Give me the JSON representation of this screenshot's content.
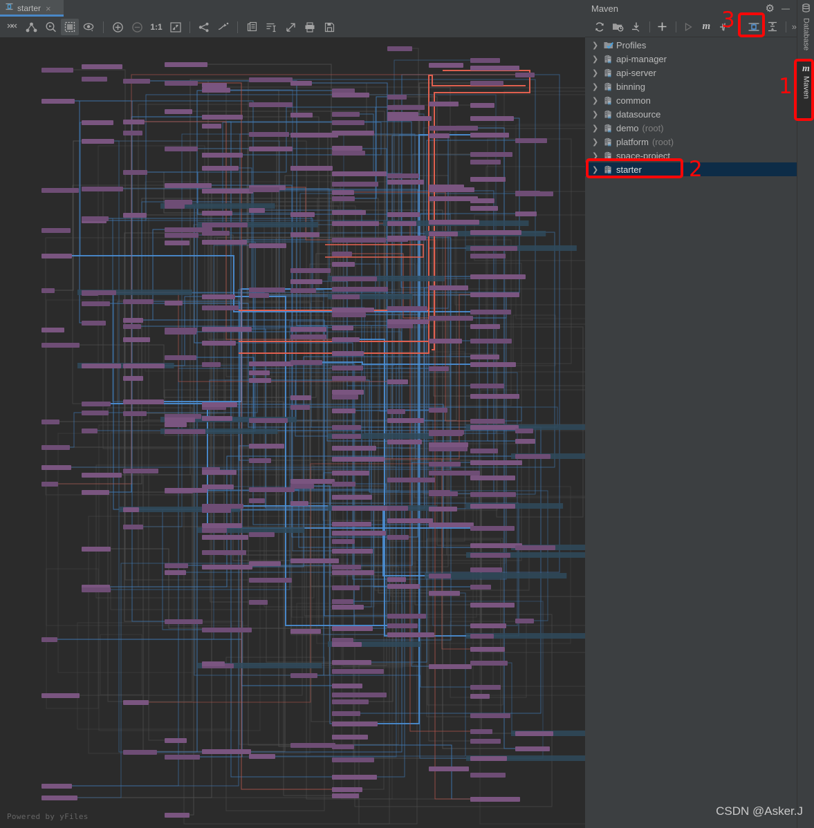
{
  "editor": {
    "tab": {
      "label": "starter",
      "icon": "dependency-diagram-icon",
      "close": "×"
    },
    "toolbar_items": [
      {
        "name": "expand-collapse-all-icon",
        "title": "Expand / Collapse"
      },
      {
        "name": "node-hierarchy-icon",
        "title": "Show hierarchy"
      },
      {
        "name": "find-node-icon",
        "title": "Find"
      },
      {
        "name": "select-region-icon",
        "title": "Selection mode",
        "selected": true
      },
      {
        "name": "visibility-eye-icon",
        "title": "Show / hide"
      },
      {
        "name": "zoom-in-icon",
        "title": "Zoom in"
      },
      {
        "name": "zoom-out-icon",
        "title": "Zoom out",
        "disabled": true
      },
      {
        "name": "actual-size-icon",
        "title": "Actual size",
        "text": "1:1"
      },
      {
        "name": "fit-content-icon",
        "title": "Fit content"
      },
      {
        "name": "layout-graph-icon",
        "title": "Apply layout"
      },
      {
        "name": "jump-to-node-icon",
        "title": "Jump to node"
      },
      {
        "name": "copy-icon",
        "title": "Copy"
      },
      {
        "name": "show-structure-icon",
        "title": "Show structure"
      },
      {
        "name": "open-externally-icon",
        "title": "Open in editor"
      },
      {
        "name": "print-icon",
        "title": "Print"
      },
      {
        "name": "export-save-icon",
        "title": "Export to file"
      }
    ],
    "credit": "Powered by yFiles"
  },
  "maven": {
    "title": "Maven",
    "header_buttons": [
      {
        "name": "gear-icon",
        "glyph": "⚙"
      },
      {
        "name": "minimize-icon",
        "glyph": "—"
      }
    ],
    "toolbar_items": [
      {
        "name": "reload-projects-icon",
        "title": "Reload All Maven Projects"
      },
      {
        "name": "generate-sources-icon",
        "title": "Generate Sources and Update Folders"
      },
      {
        "name": "download-sources-icon",
        "title": "Download Sources and/or Documentation"
      },
      {
        "name": "add-maven-project-icon",
        "title": "Add Maven Projects"
      },
      {
        "name": "run-icon",
        "title": "Run Maven Build",
        "disabled": true
      },
      {
        "name": "execute-goal-icon",
        "title": "Execute Maven Goal",
        "text": "m"
      },
      {
        "name": "toggle-skip-tests-icon",
        "title": "Toggle 'Skip Tests' Mode"
      },
      {
        "name": "show-dependencies-icon",
        "title": "Show Dependencies",
        "highlighted": true
      },
      {
        "name": "collapse-all-icon",
        "title": "Collapse All"
      },
      {
        "name": "more-actions-icon",
        "title": "More",
        "text": "»"
      }
    ],
    "tree": [
      {
        "label": "Profiles",
        "icon": "profiles-icon",
        "suffix": "",
        "selected": false
      },
      {
        "label": "api-manager",
        "icon": "maven-module-icon",
        "suffix": "",
        "selected": false
      },
      {
        "label": "api-server",
        "icon": "maven-module-icon",
        "suffix": "",
        "selected": false
      },
      {
        "label": "binning",
        "icon": "maven-module-icon",
        "suffix": "",
        "selected": false
      },
      {
        "label": "common",
        "icon": "maven-module-icon",
        "suffix": "",
        "selected": false
      },
      {
        "label": "datasource",
        "icon": "maven-module-icon",
        "suffix": "",
        "selected": false
      },
      {
        "label": "demo",
        "icon": "maven-module-icon",
        "suffix": "(root)",
        "selected": false
      },
      {
        "label": "platform",
        "icon": "maven-module-icon",
        "suffix": "(root)",
        "selected": false
      },
      {
        "label": "space-project",
        "icon": "maven-module-icon",
        "suffix": "",
        "selected": false
      },
      {
        "label": "starter",
        "icon": "maven-module-icon",
        "suffix": "",
        "selected": true
      }
    ]
  },
  "stripe": [
    {
      "name": "tool-window-database",
      "label": "Database",
      "icon": "database-icon",
      "active": false
    },
    {
      "name": "tool-window-maven",
      "label": "Maven",
      "icon": "maven-m-icon",
      "active": true
    }
  ],
  "annotations": [
    {
      "id": "1",
      "number": "1",
      "target": "tool-window-maven-stripe-button"
    },
    {
      "id": "2",
      "number": "2",
      "target": "maven-tree-item-starter"
    },
    {
      "id": "3",
      "number": "3",
      "target": "show-dependencies-toolbar-button"
    }
  ],
  "colors": {
    "annotation_red": "#fb0707",
    "background": "#2b2b2b",
    "panel": "#3c3f41",
    "selection": "#0d2c47",
    "node_purple": "#7a5580",
    "edge_blue": "#4a88c7",
    "edge_gray": "#5a5a5a",
    "edge_red": "#c4574a",
    "accent_blue": "#4a88c7"
  },
  "watermark": "CSDN @Asker.J"
}
